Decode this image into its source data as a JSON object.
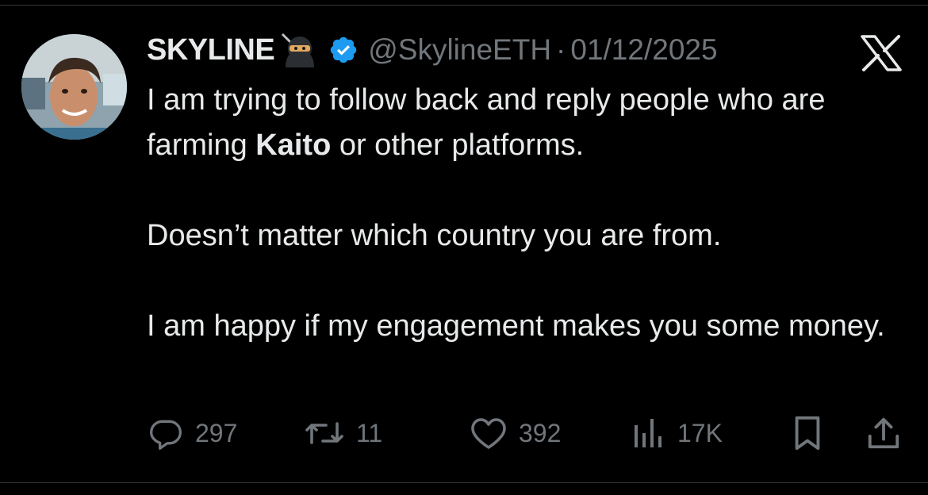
{
  "tweet": {
    "author": {
      "display_name": "SKYLINE",
      "emoji": "ninja-emoji",
      "verified": true,
      "handle": "@SkylineETH",
      "separator": "·",
      "date": "01/12/2025"
    },
    "platform_icon": "x-logo-icon",
    "text": {
      "line1_prefix": "I am trying to follow back and reply people who are farming ",
      "line1_bold": "Kaito",
      "line1_suffix": " or other platforms.",
      "paragraph2": "Doesn’t matter which country you are from.",
      "paragraph3": "I am happy if my engagement makes you some money."
    },
    "actions": {
      "replies": {
        "icon": "reply-icon",
        "count": "297"
      },
      "reposts": {
        "icon": "repost-icon",
        "count": "11"
      },
      "likes": {
        "icon": "heart-icon",
        "count": "392"
      },
      "views": {
        "icon": "views-icon",
        "count": "17K"
      },
      "bookmark": {
        "icon": "bookmark-icon"
      },
      "share": {
        "icon": "share-icon"
      }
    }
  },
  "colors": {
    "background": "#000000",
    "text": "#e7e9ea",
    "secondary": "#71767b",
    "verified": "#1d9bf0"
  }
}
